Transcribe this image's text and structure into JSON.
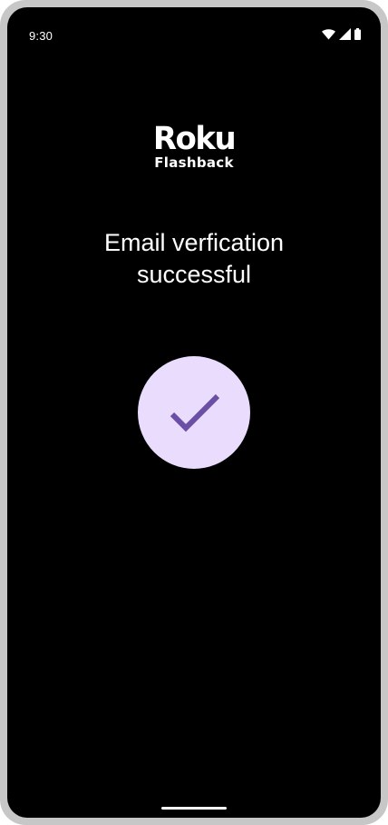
{
  "status_bar": {
    "time": "9:30",
    "icons": [
      "wifi-icon",
      "cellular-signal-icon",
      "battery-icon"
    ]
  },
  "logo": {
    "wordmark": "Roku",
    "subtitle": "Flashback"
  },
  "main": {
    "title": "Email verfication successful",
    "success_icon": "checkmark-icon"
  },
  "colors": {
    "background": "#000000",
    "circle": "#eadcfd",
    "check": "#6b4fa6",
    "text": "#ffffff"
  }
}
